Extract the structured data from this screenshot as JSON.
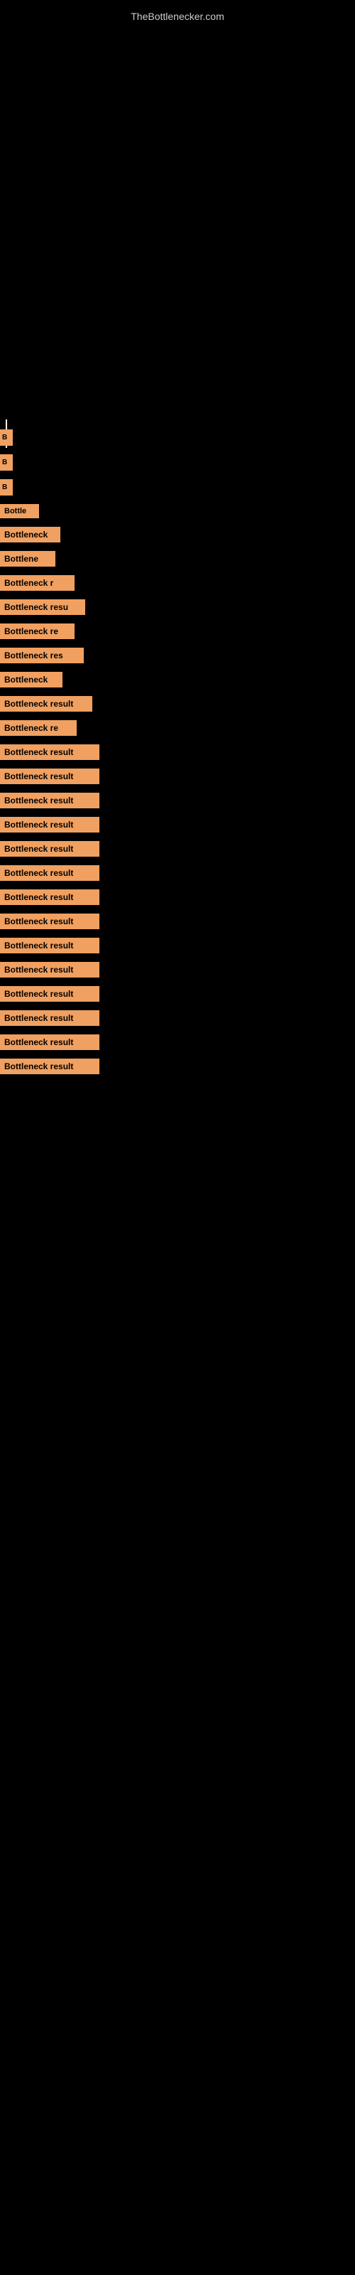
{
  "site": {
    "title": "TheBottlenecker.com"
  },
  "items": [
    {
      "id": 1,
      "label": "B",
      "class": "item-1"
    },
    {
      "id": 2,
      "label": "B",
      "class": "item-2"
    },
    {
      "id": 3,
      "label": "B",
      "class": "item-3"
    },
    {
      "id": 4,
      "label": "Bottle",
      "class": "item-4"
    },
    {
      "id": 5,
      "label": "Bottleneck",
      "class": "item-5"
    },
    {
      "id": 6,
      "label": "Bottlene",
      "class": "item-6"
    },
    {
      "id": 7,
      "label": "Bottleneck r",
      "class": "item-7"
    },
    {
      "id": 8,
      "label": "Bottleneck resu",
      "class": "item-8"
    },
    {
      "id": 9,
      "label": "Bottleneck re",
      "class": "item-9"
    },
    {
      "id": 10,
      "label": "Bottleneck res",
      "class": "item-10"
    },
    {
      "id": 11,
      "label": "Bottleneck",
      "class": "item-11"
    },
    {
      "id": 12,
      "label": "Bottleneck result",
      "class": "item-12"
    },
    {
      "id": 13,
      "label": "Bottleneck re",
      "class": "item-13"
    },
    {
      "id": 14,
      "label": "Bottleneck result",
      "class": "item-14"
    },
    {
      "id": 15,
      "label": "Bottleneck result",
      "class": "item-15"
    },
    {
      "id": 16,
      "label": "Bottleneck result",
      "class": "item-16"
    },
    {
      "id": 17,
      "label": "Bottleneck result",
      "class": "item-17"
    },
    {
      "id": 18,
      "label": "Bottleneck result",
      "class": "item-18"
    },
    {
      "id": 19,
      "label": "Bottleneck result",
      "class": "item-19"
    },
    {
      "id": 20,
      "label": "Bottleneck result",
      "class": "item-20"
    },
    {
      "id": 21,
      "label": "Bottleneck result",
      "class": "item-21"
    },
    {
      "id": 22,
      "label": "Bottleneck result",
      "class": "item-22"
    },
    {
      "id": 23,
      "label": "Bottleneck result",
      "class": "item-23"
    },
    {
      "id": 24,
      "label": "Bottleneck result",
      "class": "item-24"
    },
    {
      "id": 25,
      "label": "Bottleneck result",
      "class": "item-25"
    },
    {
      "id": 26,
      "label": "Bottleneck result",
      "class": "item-26"
    },
    {
      "id": 27,
      "label": "Bottleneck result",
      "class": "item-27"
    }
  ]
}
